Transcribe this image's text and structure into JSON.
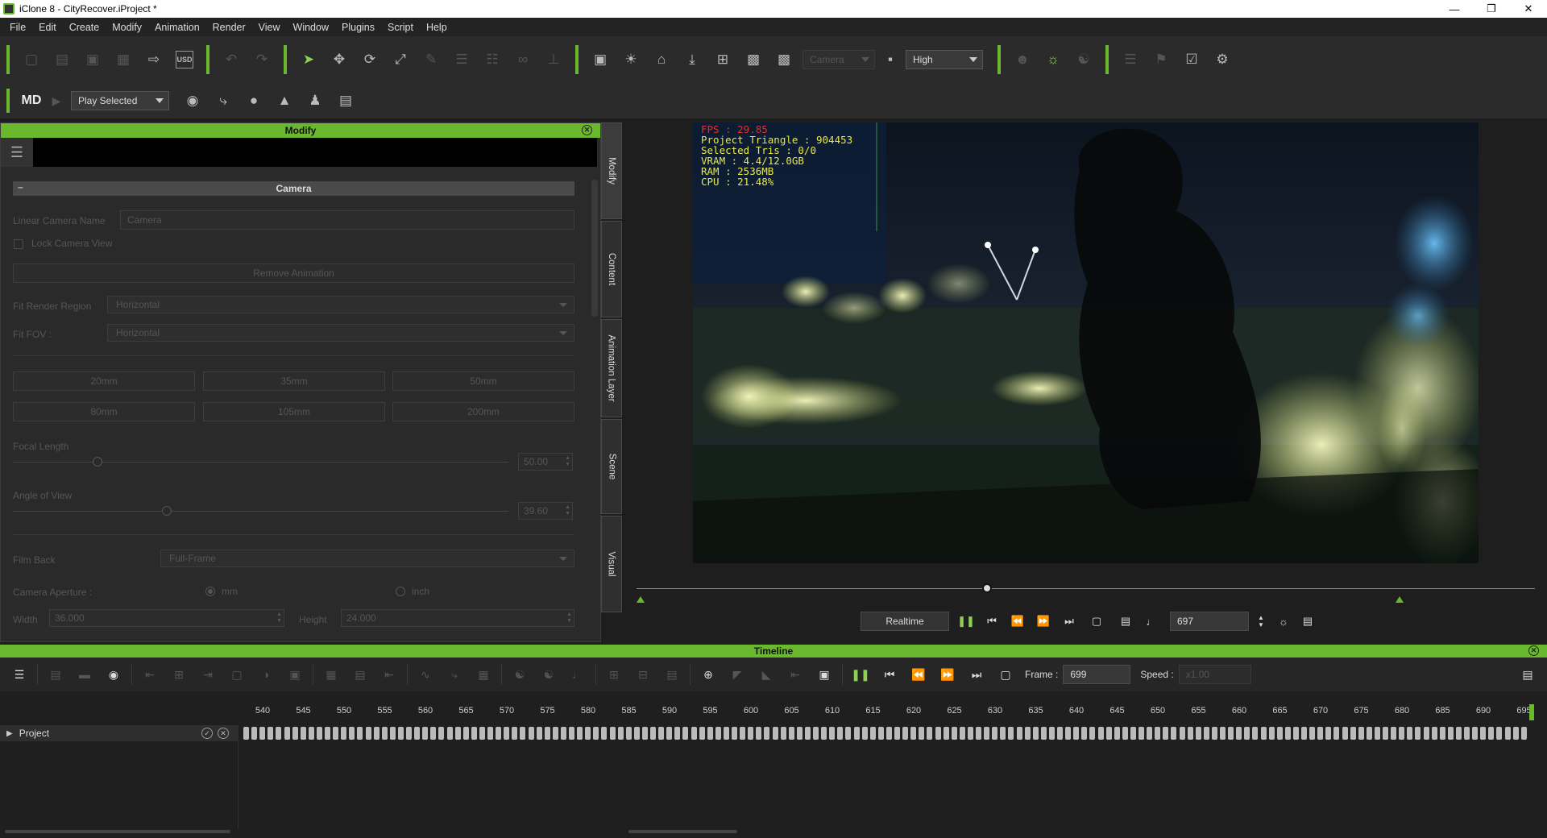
{
  "window": {
    "title": "iClone 8 - CityRecover.iProject *"
  },
  "menu": [
    "File",
    "Edit",
    "Create",
    "Modify",
    "Animation",
    "Render",
    "View",
    "Window",
    "Plugins",
    "Script",
    "Help"
  ],
  "toolbar": {
    "camera_dropdown": "Camera",
    "quality_dropdown": "High",
    "play_mode_dropdown": "Play Selected",
    "logo_text": "MD"
  },
  "modify_panel": {
    "title": "Modify",
    "section": "Camera",
    "linear_camera_name_label": "Linear Camera Name",
    "linear_camera_name_value": "Camera",
    "lock_camera_view_label": "Lock Camera View",
    "remove_animation_label": "Remove Animation",
    "fit_render_region_label": "Fit Render Region",
    "fit_render_region_value": "Horizontal",
    "fit_fov_label": "Fit FOV :",
    "fit_fov_value": "Horizontal",
    "lens_presets": [
      "20mm",
      "35mm",
      "50mm",
      "80mm",
      "105mm",
      "200mm"
    ],
    "focal_length_label": "Focal Length",
    "focal_length_value": "50.00",
    "focal_length_fraction": 0.17,
    "angle_of_view_label": "Angle of View",
    "angle_of_view_value": "39.60",
    "angle_of_view_fraction": 0.31,
    "film_back_label": "Film Back",
    "film_back_value": "Full-Frame",
    "camera_aperture_label": "Camera Aperture :",
    "unit_mm": "mm",
    "unit_inch": "inch",
    "width_label": "Width",
    "width_value": "36.000",
    "height_label": "Height",
    "height_value": "24.000"
  },
  "side_tabs": [
    "Modify",
    "Content",
    "Animation Layer",
    "Scene",
    "Visual"
  ],
  "viewport": {
    "fps": "FPS : 29.85",
    "project_triangle": "Project Triangle : 904453",
    "selected_tris": "Selected Tris : 0/0",
    "vram": "VRAM : 4.4/12.0GB",
    "ram": "RAM : 2536MB",
    "cpu": "CPU : 21.48%"
  },
  "playback": {
    "realtime_label": "Realtime",
    "current_frame": "697",
    "scrub_fraction": 0.39
  },
  "timeline": {
    "title": "Timeline",
    "frame_label": "Frame :",
    "frame_value": "699",
    "speed_label": "Speed :",
    "speed_value": "x1.00",
    "project_track": "Project",
    "ruler_ticks": [
      "540",
      "545",
      "550",
      "555",
      "560",
      "565",
      "570",
      "575",
      "580",
      "585",
      "590",
      "595",
      "600",
      "605",
      "610",
      "615",
      "620",
      "625",
      "630",
      "635",
      "640",
      "645",
      "650",
      "655",
      "660",
      "665",
      "670",
      "675",
      "680",
      "685",
      "690",
      "695"
    ]
  },
  "colors": {
    "accent_green": "#6ab82e",
    "stats_yellow": "#e8e84a",
    "fps_red": "#e03030"
  }
}
